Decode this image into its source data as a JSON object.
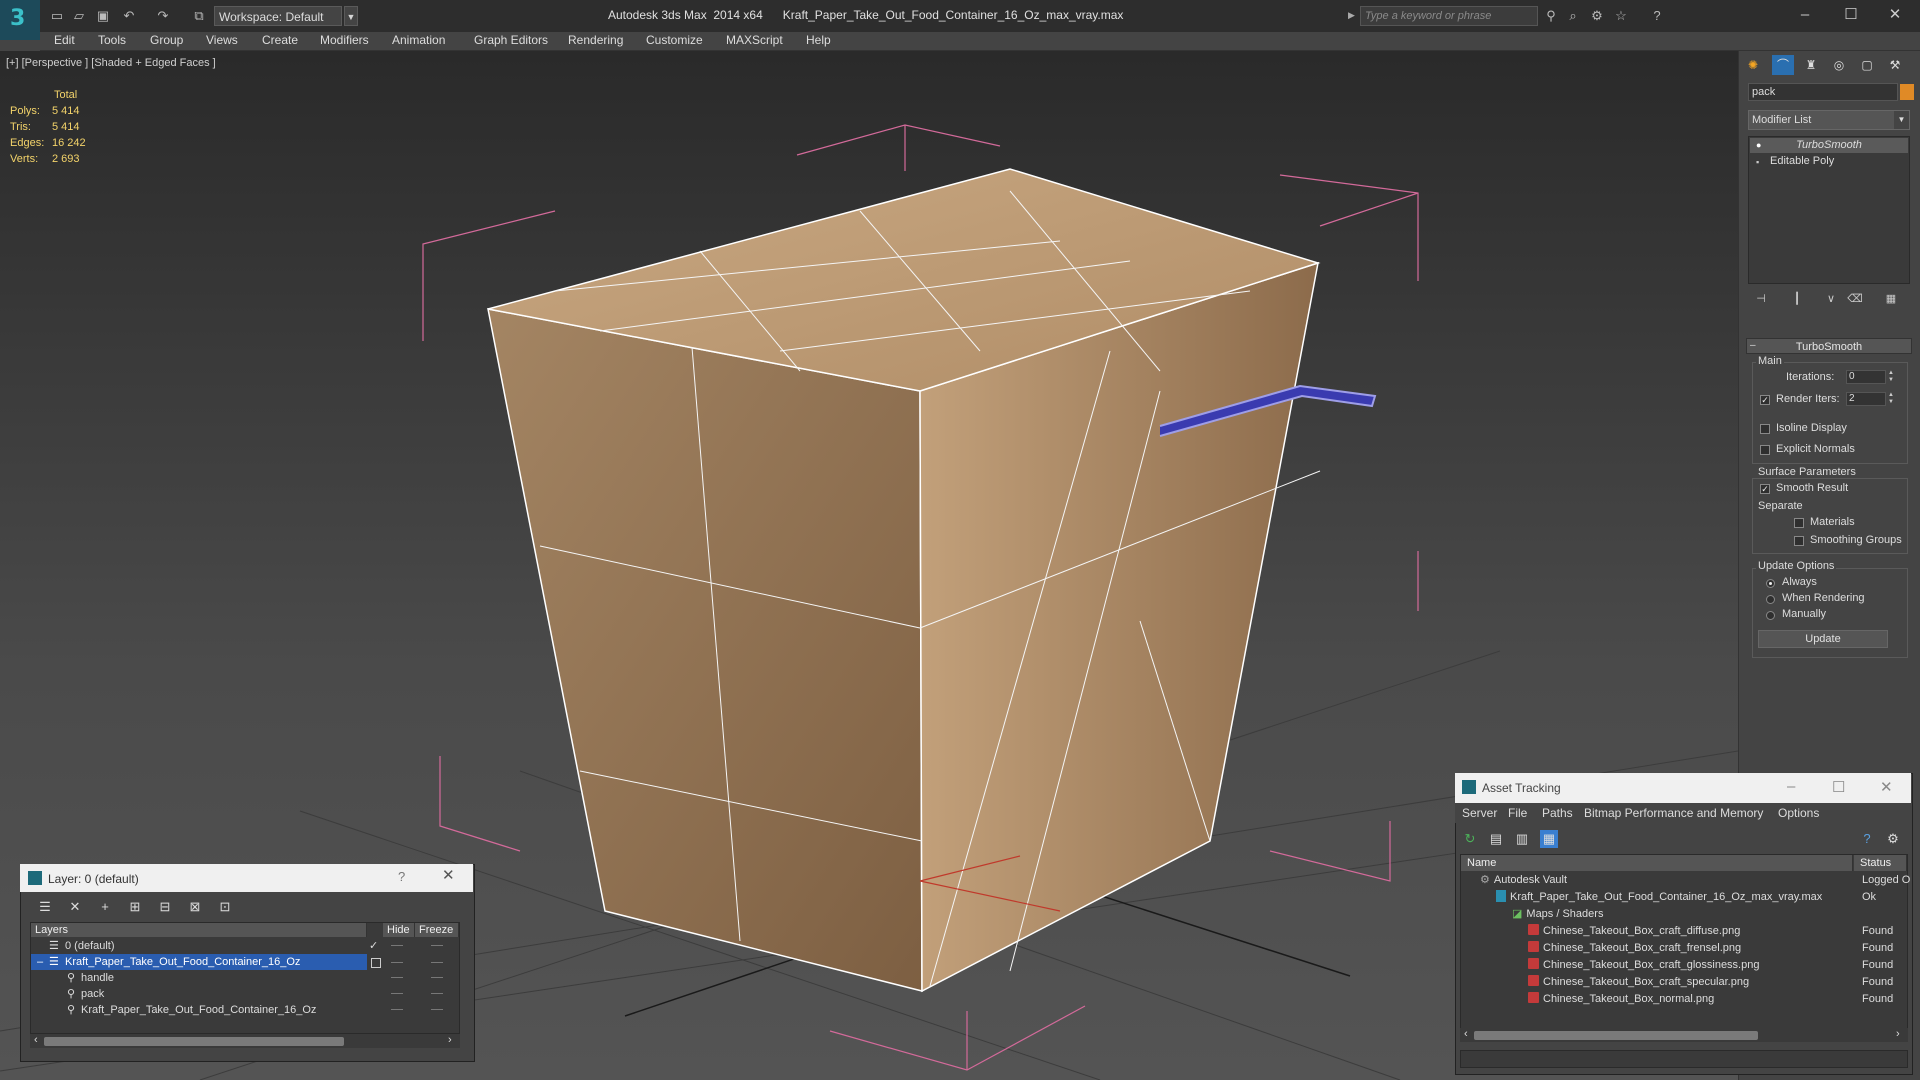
{
  "titlebar": {
    "workspace": "Workspace: Default",
    "app": "Autodesk 3ds Max  2014 x64",
    "file": "Kraft_Paper_Take_Out_Food_Container_16_Oz_max_vray.max",
    "search_placeholder": "Type a keyword or phrase"
  },
  "menu": [
    "Edit",
    "Tools",
    "Group",
    "Views",
    "Create",
    "Modifiers",
    "Animation",
    "Graph Editors",
    "Rendering",
    "Customize",
    "MAXScript",
    "Help"
  ],
  "viewport": {
    "label": "[+] [Perspective ] [Shaded + Edged Faces ]",
    "stats": {
      "header": "Total",
      "rows": [
        {
          "label": "Polys:",
          "value": "5 414"
        },
        {
          "label": "Tris:",
          "value": "5 414"
        },
        {
          "label": "Edges:",
          "value": "16 242"
        },
        {
          "label": "Verts:",
          "value": "2 693"
        }
      ]
    }
  },
  "command_panel": {
    "object_name": "pack",
    "object_color": "#e08a26",
    "modifier_list": "Modifier List",
    "stack": [
      "TurboSmooth",
      "Editable Poly"
    ],
    "rollout_title": "TurboSmooth",
    "main": {
      "title": "Main",
      "iterations_label": "Iterations:",
      "iterations_value": "0",
      "render_iters_label": "Render Iters:",
      "render_iters_value": "2",
      "isoline": "Isoline Display",
      "explicit": "Explicit Normals"
    },
    "surface": {
      "title": "Surface Parameters",
      "smooth_result": "Smooth Result",
      "separate": "Separate",
      "materials": "Materials",
      "smoothing_groups": "Smoothing Groups"
    },
    "update": {
      "title": "Update Options",
      "always": "Always",
      "when_rendering": "When Rendering",
      "manually": "Manually",
      "button": "Update"
    }
  },
  "layer_dialog": {
    "title": "Layer: 0 (default)",
    "help": "?",
    "headers": {
      "layers": "Layers",
      "hide": "Hide",
      "freeze": "Freeze"
    },
    "rows": [
      {
        "name": "0 (default)",
        "indent": 0
      },
      {
        "name": "Kraft_Paper_Take_Out_Food_Container_16_Oz",
        "indent": 0
      },
      {
        "name": "handle",
        "indent": 1
      },
      {
        "name": "pack",
        "indent": 1
      },
      {
        "name": "Kraft_Paper_Take_Out_Food_Container_16_Oz",
        "indent": 1
      }
    ]
  },
  "asset_tracking": {
    "title": "Asset Tracking",
    "menu": [
      "Server",
      "File",
      "Paths",
      "Bitmap Performance and Memory",
      "Options"
    ],
    "headers": {
      "name": "Name",
      "status": "Status"
    },
    "rows": [
      {
        "name": "Autodesk Vault",
        "status": "Logged O",
        "indent": 0
      },
      {
        "name": "Kraft_Paper_Take_Out_Food_Container_16_Oz_max_vray.max",
        "status": "Ok",
        "indent": 1
      },
      {
        "name": "Maps / Shaders",
        "status": "",
        "indent": 2
      },
      {
        "name": "Chinese_Takeout_Box_craft_diffuse.png",
        "status": "Found",
        "indent": 3
      },
      {
        "name": "Chinese_Takeout_Box_craft_frensel.png",
        "status": "Found",
        "indent": 3
      },
      {
        "name": "Chinese_Takeout_Box_craft_glossiness.png",
        "status": "Found",
        "indent": 3
      },
      {
        "name": "Chinese_Takeout_Box_craft_specular.png",
        "status": "Found",
        "indent": 3
      },
      {
        "name": "Chinese_Takeout_Box_normal.png",
        "status": "Found",
        "indent": 3
      }
    ]
  }
}
